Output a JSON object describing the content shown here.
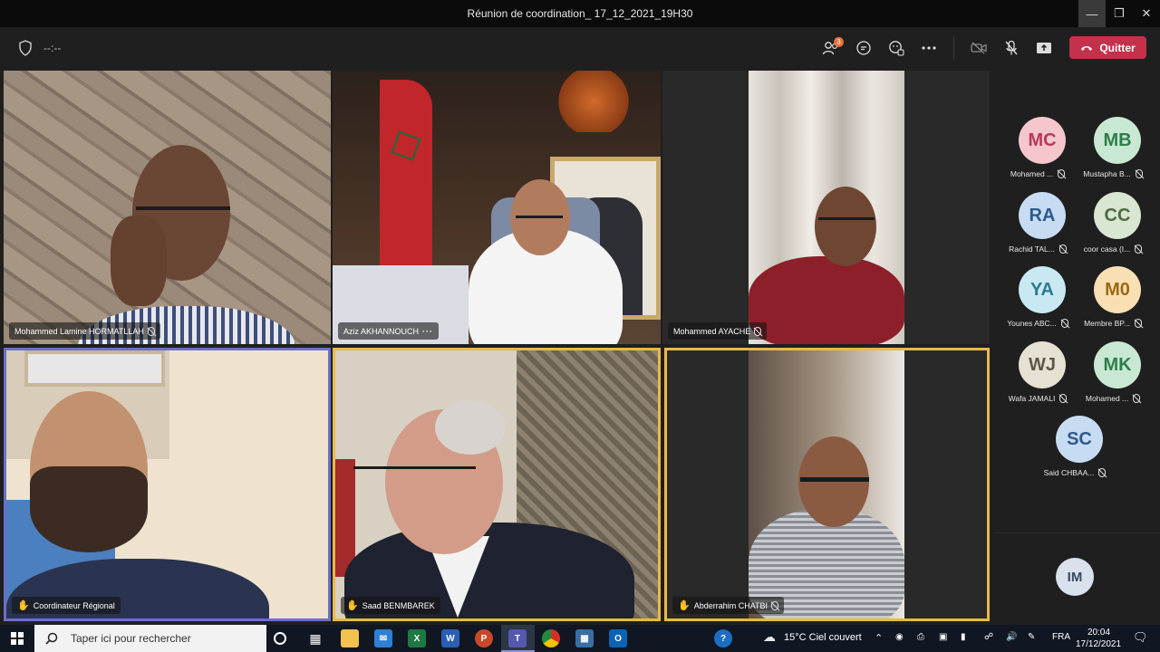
{
  "window": {
    "title": "Réunion de coordination_ 17_12_2021_19H30",
    "minimize_icon": "minimize-icon",
    "maximize_icon": "maximize-icon",
    "close_icon": "close-icon"
  },
  "toolbar": {
    "timer": "--:--",
    "participants_count": "3",
    "leave_label": "Quitter",
    "leave_color": "#c4314b"
  },
  "tiles": [
    {
      "name": "Mohammed Lamine HORMATLLAH",
      "muted": true,
      "hand_raised": false,
      "more": false,
      "border": "none"
    },
    {
      "name": "Aziz AKHANNOUCH",
      "muted": false,
      "hand_raised": false,
      "more": true,
      "border": "none"
    },
    {
      "name": "Mohammed AYACHE",
      "muted": true,
      "hand_raised": false,
      "more": false,
      "border": "none"
    },
    {
      "name": "Coordinateur Régional",
      "muted": false,
      "hand_raised": true,
      "more": false,
      "border": "#6b6fc9"
    },
    {
      "name": "Saad BENMBAREK",
      "muted": false,
      "hand_raised": true,
      "more": false,
      "border": "#e9b949"
    },
    {
      "name": "Abderrahim CHATBI",
      "muted": true,
      "hand_raised": true,
      "more": false,
      "border": "#e9b949"
    }
  ],
  "roster": [
    {
      "initials": "MC",
      "name": "Mohamed ...",
      "bg": "#f6c6cd",
      "fg": "#b73a55",
      "muted": true
    },
    {
      "initials": "MB",
      "name": "Mustapha B...",
      "bg": "#c9e8d3",
      "fg": "#2e7d4a",
      "muted": true
    },
    {
      "initials": "RA",
      "name": "Rachid TAL...",
      "bg": "#c7dbf2",
      "fg": "#2c5a8c",
      "muted": true
    },
    {
      "initials": "CC",
      "name": "coor casa (I...",
      "bg": "#d9e6d2",
      "fg": "#4d6b3c",
      "muted": true
    },
    {
      "initials": "YA",
      "name": "Younes ABC...",
      "bg": "#c9e9f2",
      "fg": "#2b7a8f",
      "muted": true
    },
    {
      "initials": "M0",
      "name": "Membre BP...",
      "bg": "#f9dfb4",
      "fg": "#9a6a17",
      "muted": true
    },
    {
      "initials": "WJ",
      "name": "Wafa JAMALI",
      "bg": "#e6e1d2",
      "fg": "#5c5747",
      "muted": true
    },
    {
      "initials": "MK",
      "name": "Mohamed ...",
      "bg": "#c9e8d3",
      "fg": "#2e7d4a",
      "muted": true
    },
    {
      "initials": "SC",
      "name": "Said CHBAA...",
      "bg": "#c7dbf2",
      "fg": "#2c5a8c",
      "muted": true
    }
  ],
  "self_avatar": {
    "initials": "IM",
    "bg": "#d9e2ec",
    "fg": "#3a4a5c"
  },
  "taskbar": {
    "search_placeholder": "Taper ici pour rechercher",
    "weather": "15°C  Ciel couvert",
    "language": "FRA",
    "time": "20:04",
    "date": "17/12/2021"
  }
}
